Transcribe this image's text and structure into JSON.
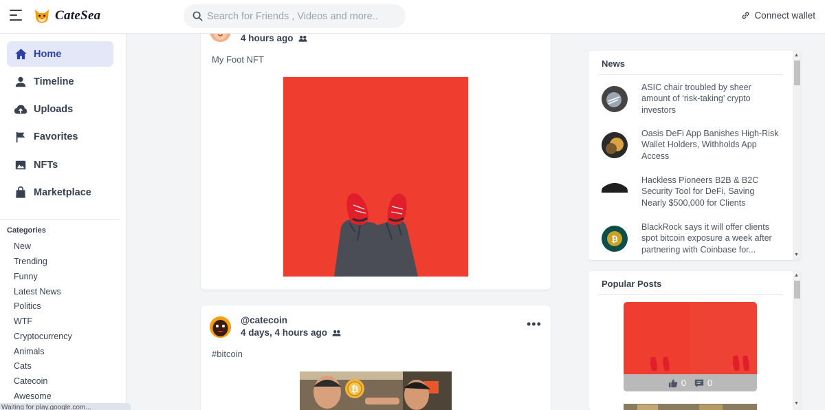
{
  "app": {
    "name": "CateSea"
  },
  "search": {
    "placeholder": "Search for Friends , Videos and more.."
  },
  "header": {
    "connect_label": "Connect wallet"
  },
  "nav": {
    "items": [
      {
        "label": "Home",
        "icon": "home-icon",
        "active": true
      },
      {
        "label": "Timeline",
        "icon": "person-icon"
      },
      {
        "label": "Uploads",
        "icon": "cloud-upload-icon"
      },
      {
        "label": "Favorites",
        "icon": "flag-icon"
      },
      {
        "label": "NFTs",
        "icon": "image-icon"
      },
      {
        "label": "Marketplace",
        "icon": "shopping-bag-icon"
      }
    ]
  },
  "categories": {
    "title": "Categories",
    "items": [
      "New",
      "Trending",
      "Funny",
      "Latest News",
      "Politics",
      "WTF",
      "Cryptocurrency",
      "Animals",
      "Cats",
      "Catecoin",
      "Awesome"
    ]
  },
  "status": {
    "text": "Waiting for play.google.com..."
  },
  "feed": {
    "posts": [
      {
        "time": "4 hours ago",
        "caption": "My Foot NFT",
        "visibility_icon": "group-icon"
      },
      {
        "username": "@catecoin",
        "time": "4 days, 4 hours ago",
        "caption": "#bitcoin",
        "visibility_icon": "group-icon"
      }
    ]
  },
  "news": {
    "title": "News",
    "items": [
      {
        "text": "ASIC chair troubled by sheer amount of ‘risk-taking’ crypto investors"
      },
      {
        "text": "Oasis DeFi App Banishes High-Risk Wallet Holders, Withholds App Access"
      },
      {
        "text": "Hackless Pioneers B2B & B2C Security Tool for DeFi, Saving Nearly $500,000 for Clients"
      },
      {
        "text": "BlackRock says it will offer clients spot bitcoin exposure a week after partnering with Coinbase for..."
      }
    ]
  },
  "popular": {
    "title": "Popular Posts",
    "items": [
      {
        "likes": "0",
        "comments": "0"
      }
    ]
  },
  "colors": {
    "accent": "#2f3fa8",
    "active_bg": "#e3e7f8",
    "nft_red": "#ef3d2f"
  }
}
